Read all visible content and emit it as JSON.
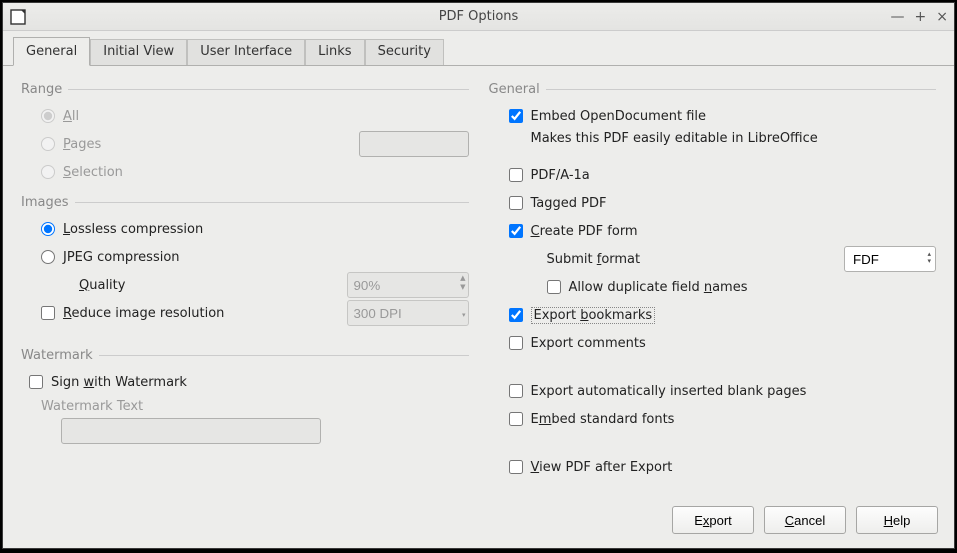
{
  "window": {
    "title": "PDF Options"
  },
  "tabs": {
    "general": "General",
    "initial_view": "Initial View",
    "user_interface": "User Interface",
    "links": "Links",
    "security": "Security"
  },
  "left": {
    "range": {
      "label": "Range",
      "all_pre": "",
      "all_u": "A",
      "all_post": "ll",
      "pages_pre": "",
      "pages_u": "P",
      "pages_post": "ages",
      "sel_pre": "",
      "sel_u": "S",
      "sel_post": "election",
      "pages_value": ""
    },
    "images": {
      "label": "Images",
      "lossless_pre": "",
      "lossless_u": "L",
      "lossless_post": "ossless compression",
      "jpeg_pre": "",
      "jpeg_u": "J",
      "jpeg_post": "PEG compression",
      "quality_pre": "",
      "quality_u": "Q",
      "quality_post": "uality",
      "quality_value": "90%",
      "reduce_pre": "",
      "reduce_u": "R",
      "reduce_post": "educe image resolution",
      "dpi_value": "300 DPI"
    },
    "watermark": {
      "label": "Watermark",
      "sign_pre": "Sign ",
      "sign_u": "w",
      "sign_post": "ith Watermark",
      "text_label": "Watermark Text",
      "text_value": ""
    }
  },
  "right": {
    "label": "General",
    "embed": {
      "label": "Embed OpenDocument file",
      "desc": "Makes this PDF easily editable in LibreOffice"
    },
    "pdfa": "PDF/A-1a",
    "tagged": "Tagged PDF",
    "form_pre": "",
    "form_u": "C",
    "form_post": "reate PDF form",
    "submit_pre": "Submit ",
    "submit_u": "f",
    "submit_post": "ormat",
    "submit_value": "FDF",
    "dup_pre": "Allow duplicate field ",
    "dup_u": "n",
    "dup_post": "ames",
    "bookmarks_pre": "Export ",
    "bookmarks_u": "b",
    "bookmarks_post": "ookmarks",
    "comments": "Export comments",
    "blank": "Export automatically inserted blank pages",
    "fonts_pre": "E",
    "fonts_u": "m",
    "fonts_post": "bed standard fonts",
    "view_pre": "",
    "view_u": "V",
    "view_post": "iew PDF after Export"
  },
  "footer": {
    "export_pre": "E",
    "export_u": "x",
    "export_post": "port",
    "cancel_pre": "",
    "cancel_u": "C",
    "cancel_post": "ancel",
    "help_pre": "",
    "help_u": "H",
    "help_post": "elp"
  }
}
